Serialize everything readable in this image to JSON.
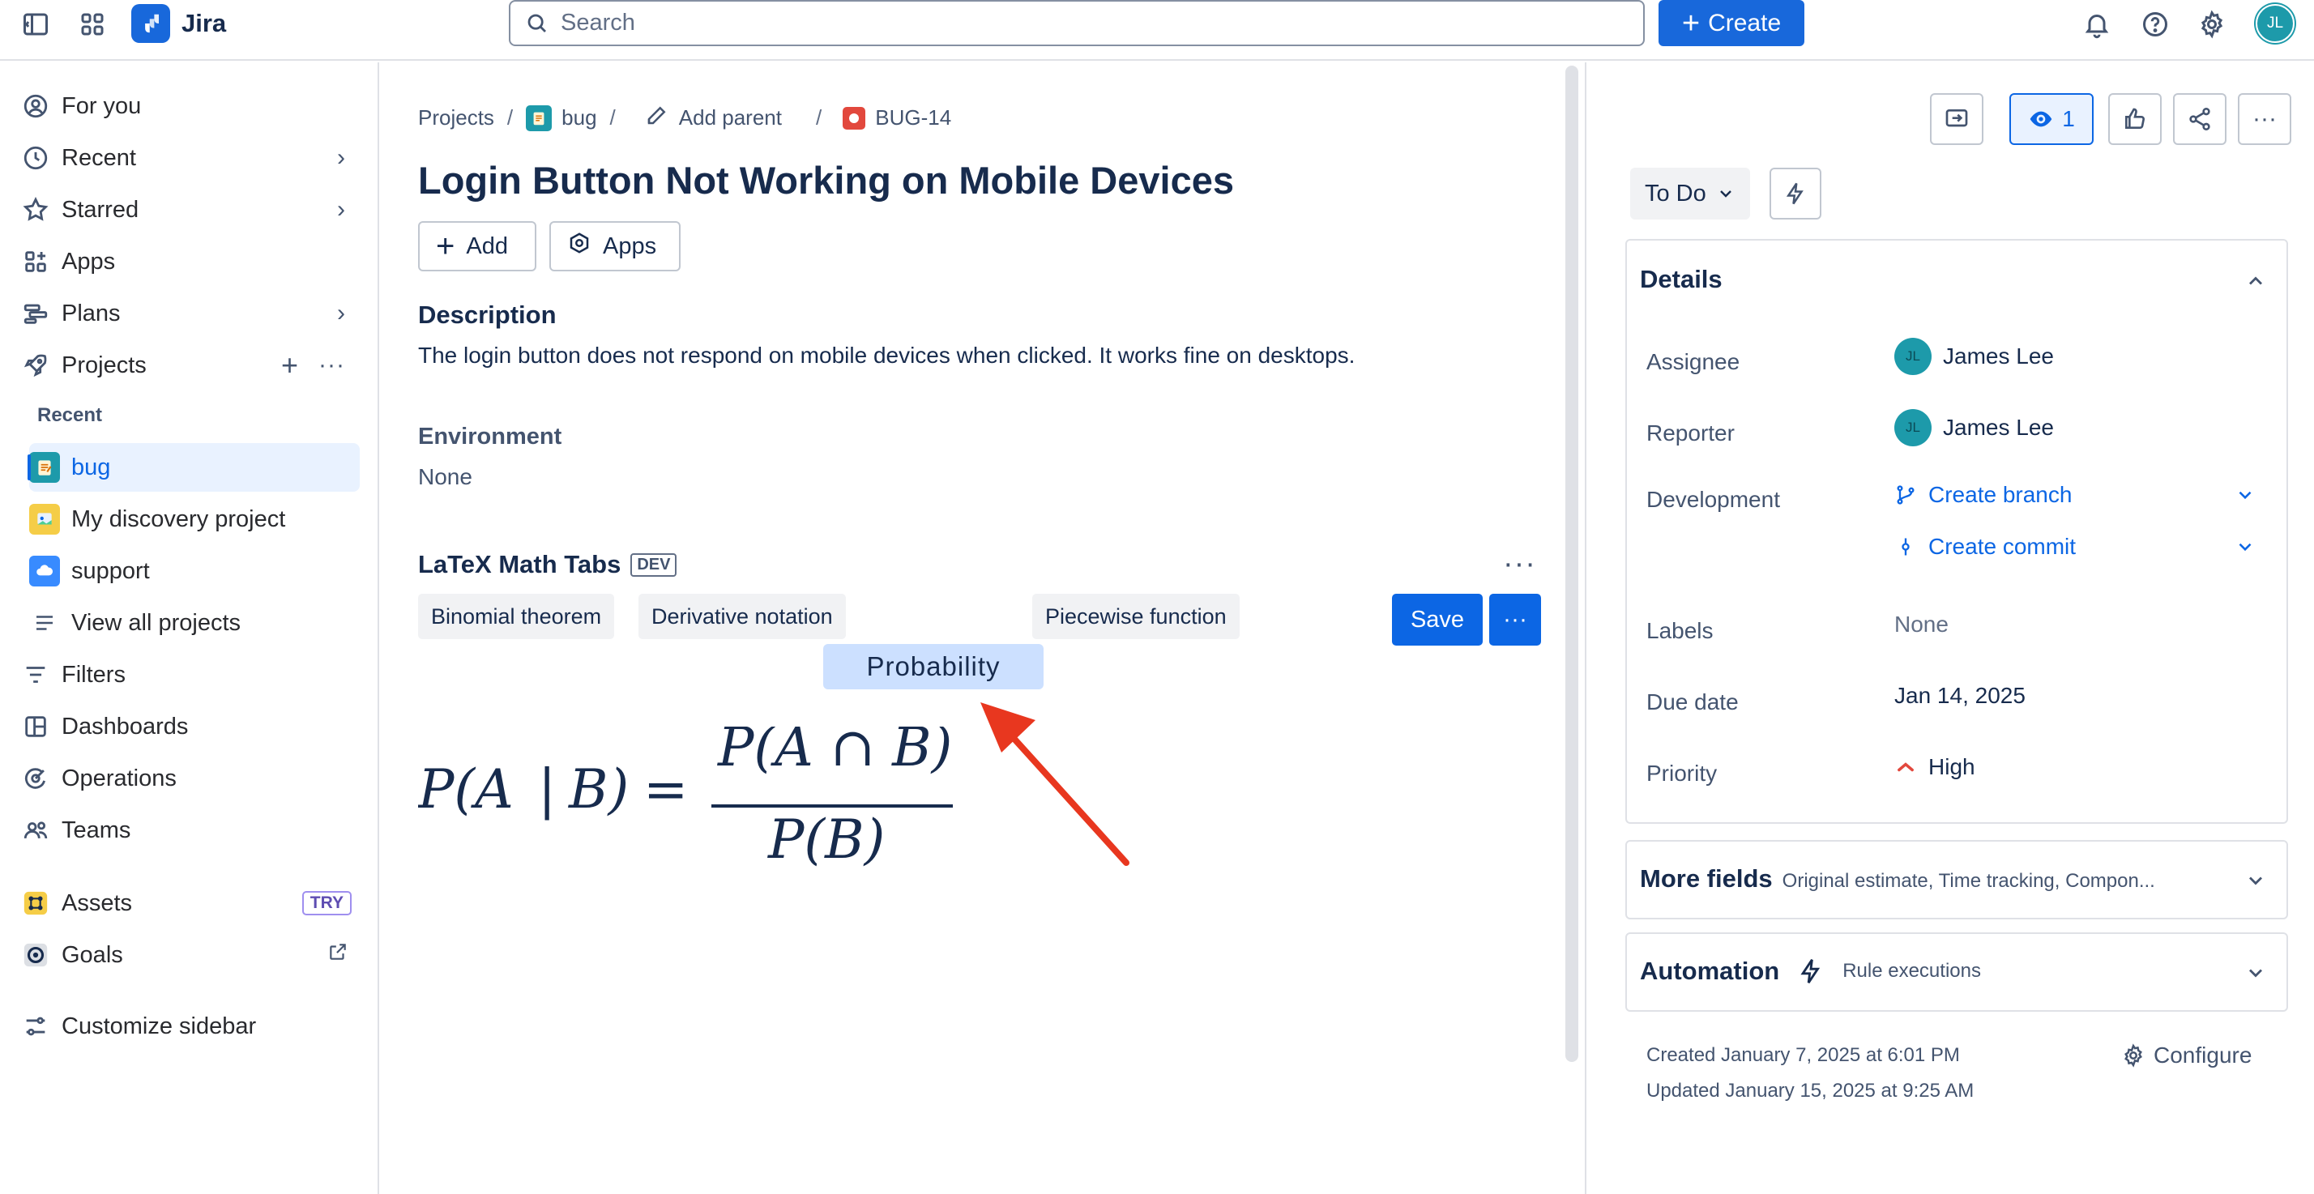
{
  "topbar": {
    "app_name": "Jira",
    "search_placeholder": "Search",
    "create_label": "Create",
    "avatar_initials": "JL"
  },
  "sidebar": {
    "for_you": "For you",
    "recent": "Recent",
    "starred": "Starred",
    "apps": "Apps",
    "plans": "Plans",
    "projects": "Projects",
    "recent_label": "Recent",
    "project_bug": "bug",
    "project_discovery": "My discovery project",
    "project_support": "support",
    "view_all": "View all projects",
    "filters": "Filters",
    "dashboards": "Dashboards",
    "operations": "Operations",
    "teams": "Teams",
    "assets": "Assets",
    "try_badge": "TRY",
    "goals": "Goals",
    "customize": "Customize sidebar"
  },
  "main": {
    "breadcrumb": {
      "projects": "Projects",
      "project": "bug",
      "add_parent": "Add parent",
      "issue_key": "BUG-14"
    },
    "title": "Login Button Not Working on Mobile Devices",
    "add_label": "Add",
    "apps_label": "Apps",
    "description_heading": "Description",
    "description_text": "The login button does not respond on mobile devices when clicked. It works fine on desktops.",
    "environment_heading": "Environment",
    "environment_value": "None",
    "latex": {
      "heading": "LaTeX Math Tabs",
      "badge": "DEV",
      "tabs": [
        "Binomial theorem",
        "Derivative notation",
        "Piecewise function"
      ],
      "dragging_tab": "Probability",
      "save_label": "Save"
    }
  },
  "right": {
    "watch_count": "1",
    "status": "To Do",
    "details_title": "Details",
    "fields": {
      "assignee_label": "Assignee",
      "assignee_initials": "JL",
      "assignee_value": "James Lee",
      "reporter_label": "Reporter",
      "reporter_initials": "JL",
      "reporter_value": "James Lee",
      "development_label": "Development",
      "create_branch": "Create branch",
      "create_commit": "Create commit",
      "labels_label": "Labels",
      "labels_value": "None",
      "due_label": "Due date",
      "due_value": "Jan 14, 2025",
      "priority_label": "Priority",
      "priority_value": "High"
    },
    "more_fields_title": "More fields",
    "more_fields_sub": "Original estimate, Time tracking, Compon...",
    "automation_title": "Automation",
    "automation_sub": "Rule executions",
    "created": "Created January 7, 2025 at 6:01 PM",
    "updated": "Updated January 15, 2025 at 9:25 AM",
    "configure": "Configure"
  },
  "colors": {
    "brand": "#1868db",
    "primary_button": "#0c66e4",
    "selected_nav": "#e9f2ff",
    "drag_tab": "#cce0ff",
    "arrow": "#e8371f",
    "priority_high": "#e2483d"
  }
}
